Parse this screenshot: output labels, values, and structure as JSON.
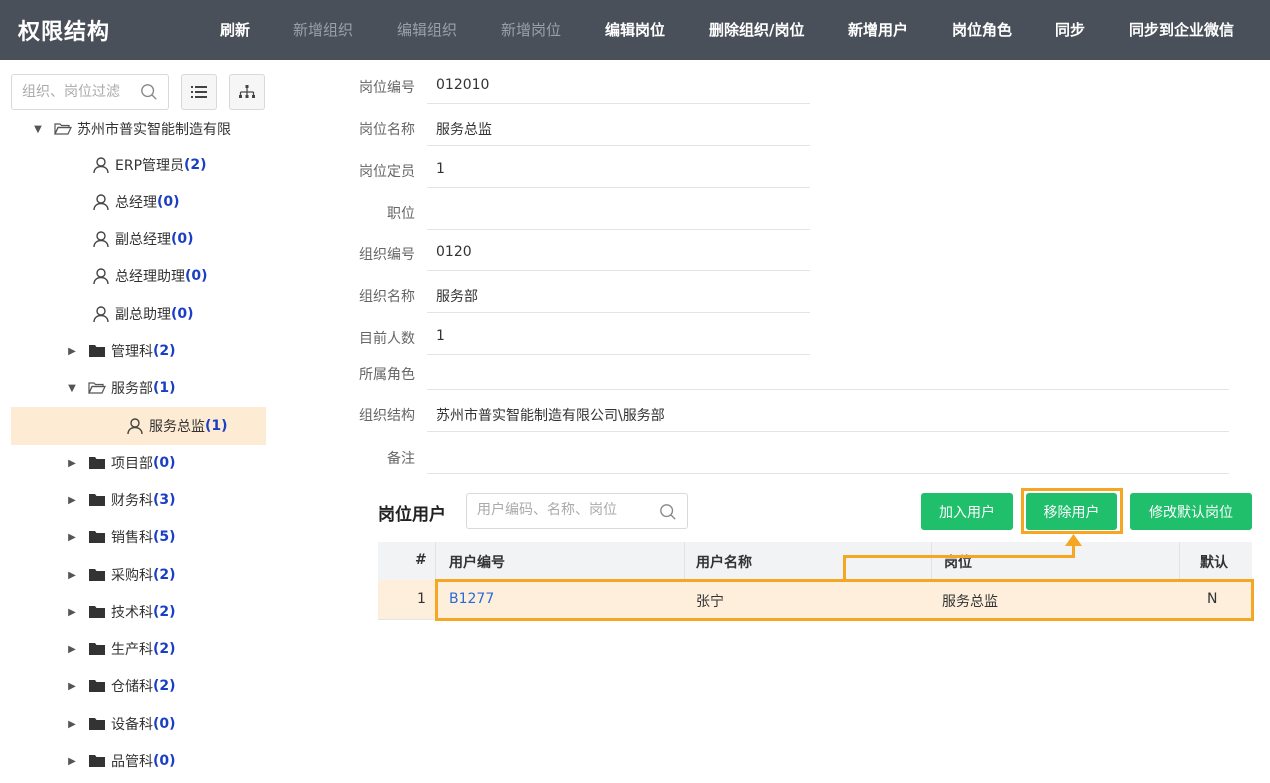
{
  "app_title": "权限结构",
  "toolbar": [
    {
      "label": "刷新",
      "enabled": true
    },
    {
      "label": "新增组织",
      "enabled": false
    },
    {
      "label": "编辑组织",
      "enabled": false
    },
    {
      "label": "新增岗位",
      "enabled": false
    },
    {
      "label": "编辑岗位",
      "enabled": true
    },
    {
      "label": "删除组织/岗位",
      "enabled": true
    },
    {
      "label": "新增用户",
      "enabled": true
    },
    {
      "label": "岗位角色",
      "enabled": true
    },
    {
      "label": "同步",
      "enabled": true
    },
    {
      "label": "同步到企业微信",
      "enabled": true
    }
  ],
  "sidebar": {
    "search_placeholder": "组织、岗位过滤",
    "tree": [
      {
        "type": "root",
        "label": "苏州市普实智能制造有限",
        "count": "",
        "expanded": true
      },
      {
        "type": "post",
        "label": "ERP管理员",
        "count": "(2)"
      },
      {
        "type": "post",
        "label": "总经理",
        "count": "(0)"
      },
      {
        "type": "post",
        "label": "副总经理",
        "count": "(0)"
      },
      {
        "type": "post",
        "label": "总经理助理",
        "count": "(0)"
      },
      {
        "type": "post",
        "label": "副总助理",
        "count": "(0)"
      },
      {
        "type": "folder",
        "label": "管理科",
        "count": "(2)",
        "expanded": false
      },
      {
        "type": "folder",
        "label": "服务部",
        "count": "(1)",
        "expanded": true
      },
      {
        "type": "post-selected",
        "label": "服务总监",
        "count": "(1)"
      },
      {
        "type": "folder",
        "label": "项目部",
        "count": "(0)",
        "expanded": false
      },
      {
        "type": "folder",
        "label": "财务科",
        "count": "(3)",
        "expanded": false
      },
      {
        "type": "folder",
        "label": "销售科",
        "count": "(5)",
        "expanded": false
      },
      {
        "type": "folder",
        "label": "采购科",
        "count": "(2)",
        "expanded": false
      },
      {
        "type": "folder",
        "label": "技术科",
        "count": "(2)",
        "expanded": false
      },
      {
        "type": "folder",
        "label": "生产科",
        "count": "(2)",
        "expanded": false
      },
      {
        "type": "folder",
        "label": "仓储科",
        "count": "(2)",
        "expanded": false
      },
      {
        "type": "folder",
        "label": "设备科",
        "count": "(0)",
        "expanded": false
      },
      {
        "type": "folder",
        "label": "品管科",
        "count": "(0)",
        "expanded": false
      }
    ]
  },
  "form": {
    "fields": [
      {
        "label": "岗位编号",
        "value": "012010"
      },
      {
        "label": "岗位名称",
        "value": "服务总监"
      },
      {
        "label": "岗位定员",
        "value": "1"
      },
      {
        "label": "职位",
        "value": ""
      },
      {
        "label": "组织编号",
        "value": "0120"
      },
      {
        "label": "组织名称",
        "value": "服务部"
      },
      {
        "label": "目前人数",
        "value": "1"
      },
      {
        "label": "所属角色",
        "value": ""
      },
      {
        "label": "组织结构",
        "value": "苏州市普实智能制造有限公司\\服务部"
      },
      {
        "label": "备注",
        "value": ""
      }
    ]
  },
  "users": {
    "title": "岗位用户",
    "search_placeholder": "用户编码、名称、岗位",
    "buttons": {
      "add": "加入用户",
      "remove": "移除用户",
      "modify_default": "修改默认岗位"
    },
    "columns": [
      "#",
      "用户编号",
      "用户名称",
      "岗位",
      "默认"
    ],
    "rows": [
      {
        "index": "1",
        "code": "B1277",
        "name": "张宁",
        "post": "服务总监",
        "default": "N"
      }
    ]
  },
  "colors": {
    "topbar": "#4a5059",
    "accent_green": "#1fbf6b",
    "highlight": "#f5a623",
    "selected_bg": "#fdebd3",
    "count_blue": "#1a3fc4"
  }
}
